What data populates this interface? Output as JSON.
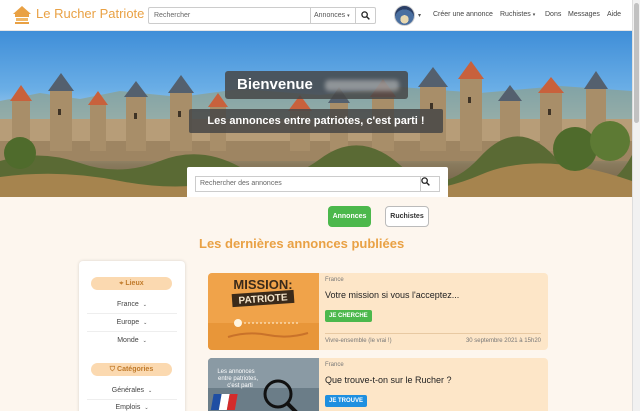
{
  "header": {
    "brand": "Le Rucher Patriote",
    "search_placeholder": "Rechercher",
    "search_scope": "Annonces",
    "nav": {
      "create": "Créer une annonce",
      "beekeepers": "Ruchistes",
      "donations": "Dons",
      "messages": "Messages",
      "help": "Aide"
    }
  },
  "hero": {
    "welcome": "Bienvenue",
    "tagline": "Les annonces entre patriotes, c'est parti !",
    "search_placeholder": "Rechercher des annonces"
  },
  "tabs": [
    "Annonces",
    "Ruchistes"
  ],
  "section_title": "Les dernières annonces publiées",
  "sidebar": {
    "places_label": "Lieux",
    "places": [
      "France",
      "Europe",
      "Monde"
    ],
    "categories_label": "Catégories",
    "categories": [
      "Générales",
      "Emplois"
    ]
  },
  "cards": [
    {
      "image_line1": "MISSION:",
      "image_line2": "PATRIOTE",
      "country": "France",
      "title": "Votre mission si vous l'acceptez...",
      "badge": "JE CHERCHE",
      "location": "Vivre-ensemble (le vrai !)",
      "date": "30 septembre 2021 à 15h20"
    },
    {
      "image_line1": "Les annonces",
      "image_line2": "entre patriotes,",
      "image_line3": "c'est parti",
      "country": "France",
      "title": "Que trouve-t-on sur le Rucher ?",
      "badge": "JE TROUVE"
    }
  ],
  "colors": {
    "brand": "#e9a144",
    "active_tab": "#4cb84c",
    "seek_badge": "#4cb84c",
    "find_badge": "#1e8fe0"
  }
}
